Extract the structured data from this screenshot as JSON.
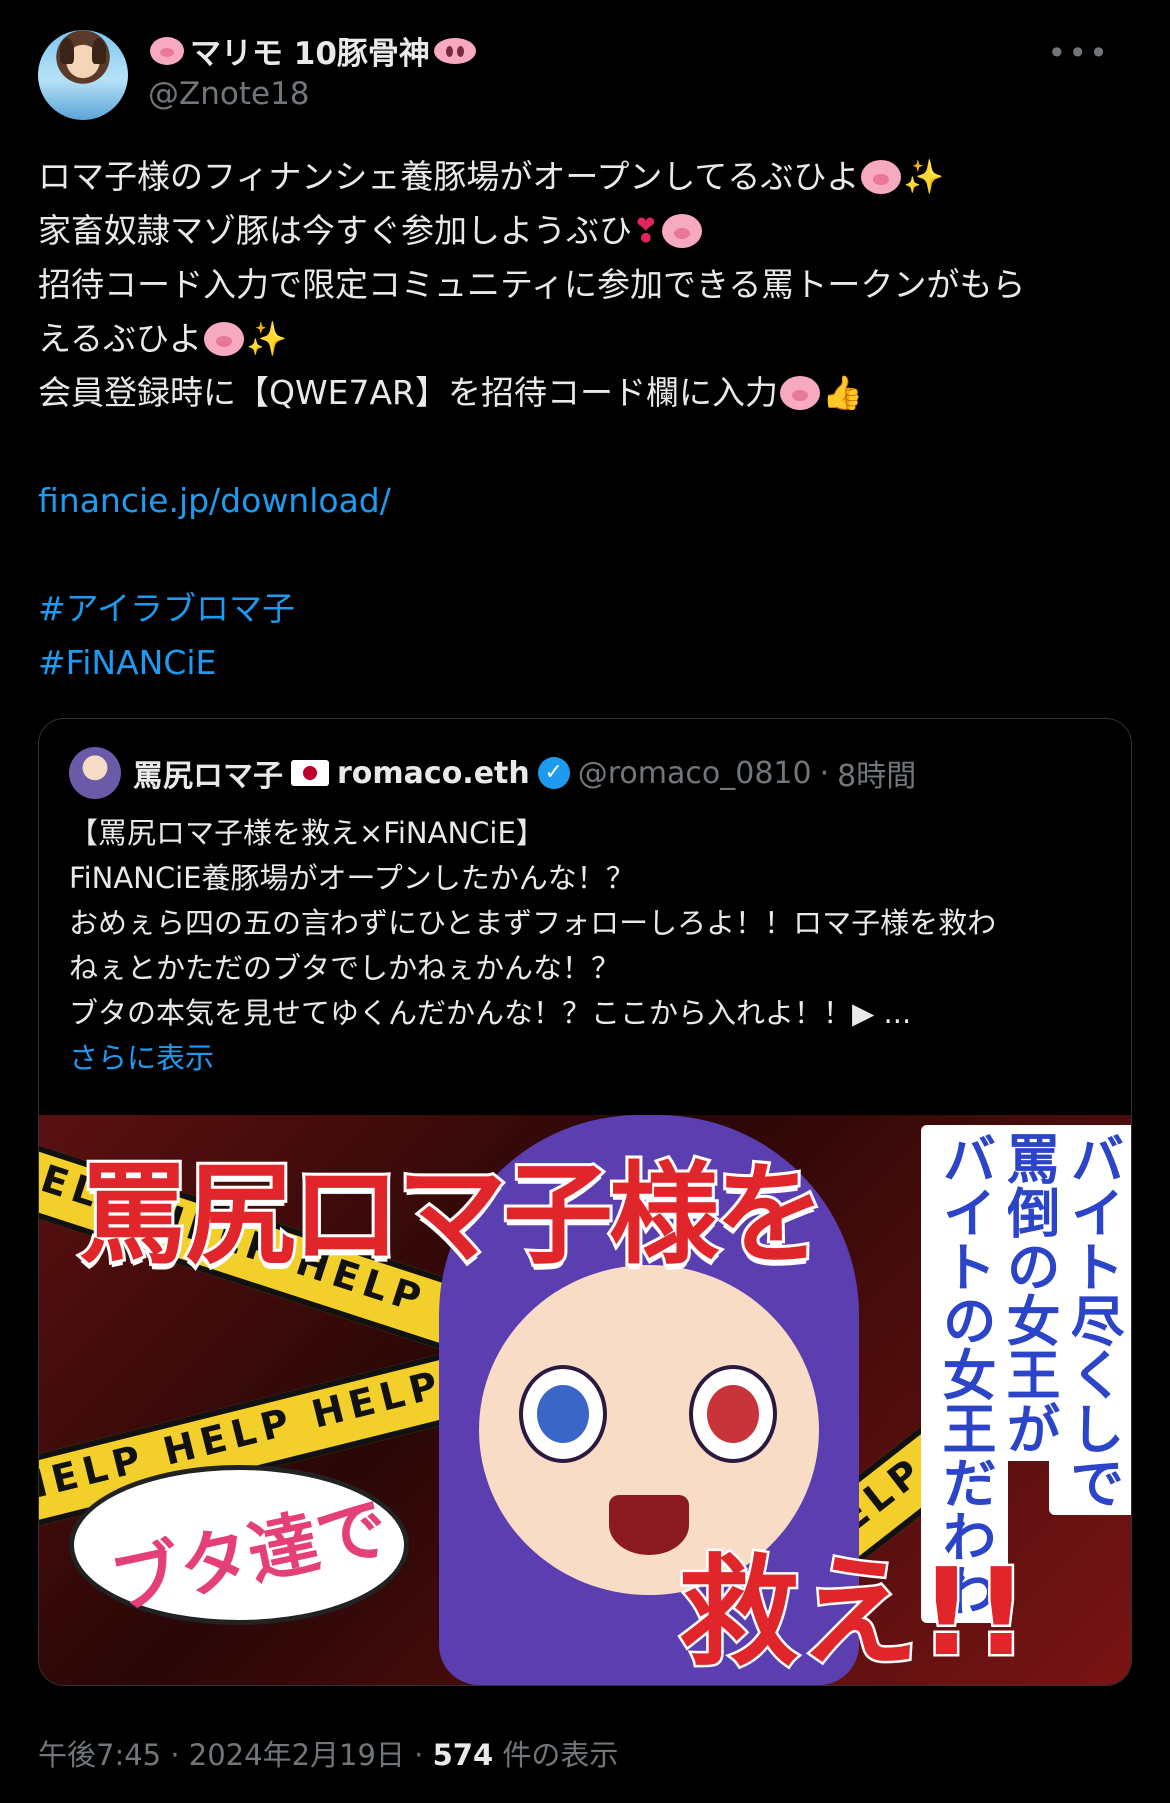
{
  "post": {
    "display_name": "マリモ 10豚骨神",
    "handle": "@Znote18",
    "more_icon": "more-horizontal-icon",
    "lines": [
      "ロマ子様のフィナンシェ養豚場がオープンしてるぶひよ",
      "家畜奴隷マゾ豚は今すぐ参加しようぶひ",
      "招待コード入力で限定コミュニティに参加できる罵トークンがもら",
      "えるぶひよ",
      "会員登録時に【QWE7AR】を招待コード欄に入力"
    ],
    "link": "financie.jp/download/",
    "hashtags": [
      "#アイラブロマ子",
      "#FiNANCiE"
    ]
  },
  "quote": {
    "name_part1": "罵尻ロマ子",
    "name_part2": "romaco.eth",
    "handle": "@romaco_0810",
    "separator": "·",
    "time": "8時間",
    "lines": [
      "【罵尻ロマ子様を救え×FiNANCiE】",
      "FiNANCiE養豚場がオープンしたかんな！？",
      "おめぇら四の五の言わずにひとまずフォローしろよ！！ロマ子様を救わ",
      "ねぇとかただのブタでしかねぇかんな！？",
      "ブタの本気を見せてゆくんだかんな！？ここから入れよ！！▶ ..."
    ],
    "show_more": "さらに表示",
    "image": {
      "title": "罵尻ロマ子様を",
      "vertical_1": "バイト尽くしで",
      "vertical_2": "罵倒の女王が",
      "vertical_3": "バイトの女王だわわ",
      "bubble": "ブタ達で",
      "save": "救え!!",
      "tape_text": "HELP HELP HELP"
    }
  },
  "footer": {
    "time": "午後7:45",
    "sep1": "·",
    "date": "2024年2月19日",
    "sep2": "·",
    "views_count": "574",
    "views_label": "件の表示"
  }
}
